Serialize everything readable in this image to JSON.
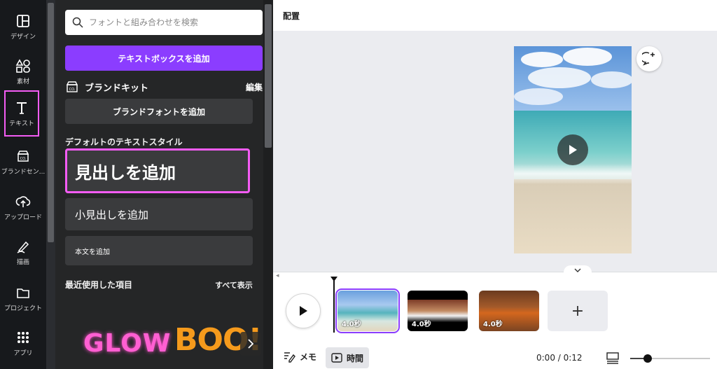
{
  "rail": {
    "items": [
      {
        "label": "デザイン",
        "icon": "layout-icon"
      },
      {
        "label": "素材",
        "icon": "elements-icon"
      },
      {
        "label": "テキスト",
        "icon": "text-icon"
      },
      {
        "label": "ブランドセン...",
        "icon": "brand-icon"
      },
      {
        "label": "アップロード",
        "icon": "upload-icon"
      },
      {
        "label": "描画",
        "icon": "draw-icon"
      },
      {
        "label": "プロジェクト",
        "icon": "folder-icon"
      },
      {
        "label": "アプリ",
        "icon": "apps-icon"
      }
    ],
    "active_index": 2,
    "active_outline_color": "#f45cf4"
  },
  "panel": {
    "search_placeholder": "フォントと組み合わせを検索",
    "add_textbox_label": "テキストボックスを追加",
    "brand_kit_label": "ブランドキット",
    "brand_kit_edit": "編集",
    "add_brand_font_label": "ブランドフォントを追加",
    "default_styles_title": "デフォルトのテキストスタイル",
    "add_heading": "見出しを追加",
    "add_subheading": "小見出しを追加",
    "add_body": "本文を追加",
    "recent_title": "最近使用した項目",
    "recent_show_all": "すべて表示",
    "recent_items": [
      "GLOW",
      "BOO!"
    ]
  },
  "canvas": {
    "title": "配置"
  },
  "timeline": {
    "clips": [
      {
        "duration": "4.0秒",
        "selected": true
      },
      {
        "duration": "4.0秒",
        "selected": false
      },
      {
        "duration": "4.0秒",
        "selected": false
      }
    ],
    "add_label": "+"
  },
  "bottombar": {
    "memo_label": "メモ",
    "time_label": "時間",
    "timecode": "0:00 / 0:12",
    "zoom_fraction": 0.22
  },
  "colors": {
    "accent": "#8b3dff",
    "highlight": "#f45cf4"
  }
}
